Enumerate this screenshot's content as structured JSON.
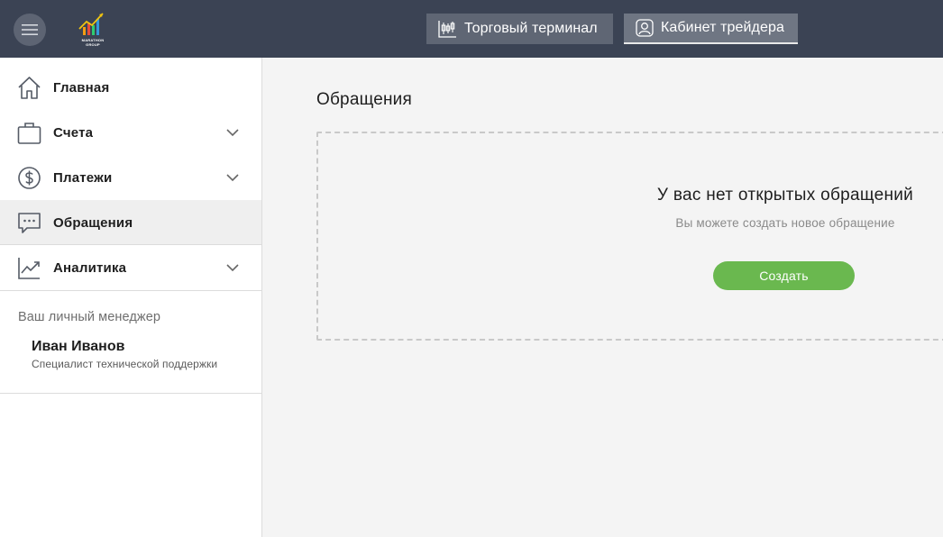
{
  "header": {
    "menu_icon": "hamburger-icon",
    "logo_text": "MARATHON GROUP",
    "terminal_label": "Торговый терминал",
    "terminal_icon": "candlestick-chart-icon",
    "cabinet_label": "Кабинет трейдера",
    "cabinet_icon": "user-icon"
  },
  "sidebar": {
    "items": [
      {
        "label": "Главная",
        "icon": "home-icon",
        "has_children": false
      },
      {
        "label": "Счета",
        "icon": "briefcase-icon",
        "has_children": true
      },
      {
        "label": "Платежи",
        "icon": "dollar-coin-icon",
        "has_children": true
      },
      {
        "label": "Обращения",
        "icon": "chat-icon",
        "has_children": false,
        "active": true
      },
      {
        "label": "Аналитика",
        "icon": "trend-chart-icon",
        "has_children": true
      }
    ],
    "manager": {
      "title": "Ваш личный менеджер",
      "name": "Иван Иванов",
      "role": "Специалист технической поддержки"
    }
  },
  "main": {
    "title": "Обращения",
    "empty_state": {
      "title": "У вас нет открытых обращений",
      "subtitle": "Вы можете создать новое обращение",
      "button_label": "Создать"
    }
  },
  "colors": {
    "topbar": "#3b4354",
    "accent_green": "#6ab84f",
    "active_item": "#efefef"
  }
}
